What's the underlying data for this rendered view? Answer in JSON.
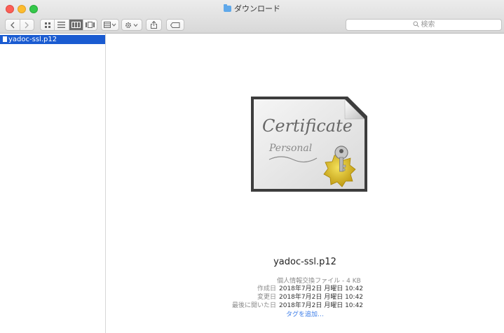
{
  "window": {
    "title": "ダウンロード"
  },
  "toolbar": {
    "back_icon": "chevron-left-icon",
    "forward_icon": "chevron-right-icon",
    "view_modes": [
      "icon-view",
      "list-view",
      "column-view",
      "gallery-view"
    ],
    "active_view": "column-view",
    "search_placeholder": "検索"
  },
  "sidebar": {
    "selected_item": "yadoc-ssl.p12"
  },
  "preview": {
    "file_name": "yadoc-ssl.p12",
    "kind": "個人情報交換ファイル - 4 KB",
    "rows": [
      {
        "label": "作成日",
        "value": "2018年7月2日 月曜日 10:42"
      },
      {
        "label": "変更日",
        "value": "2018年7月2日 月曜日 10:42"
      },
      {
        "label": "最後に開いた日",
        "value": "2018年7月2日 月曜日 10:42"
      }
    ],
    "add_tags": "タグを追加…",
    "image_text": {
      "line1": "Certificate",
      "line2": "Personal"
    }
  },
  "colors": {
    "selection": "#1a5bd1",
    "link": "#3c7de8"
  }
}
